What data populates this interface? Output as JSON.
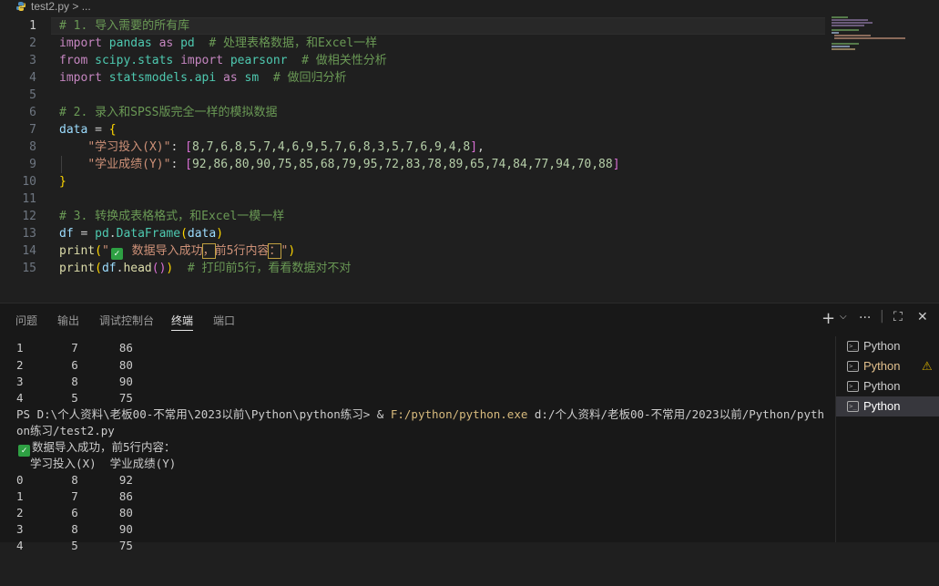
{
  "breadcrumb": {
    "file": "test2.py",
    "sep": " > ..."
  },
  "editor": {
    "line_numbers": [
      "1",
      "2",
      "3",
      "4",
      "5",
      "6",
      "7",
      "8",
      "9",
      "10",
      "11",
      "12",
      "13",
      "14",
      "15"
    ],
    "lines": {
      "l1_comment": "# 1. 导入需要的所有库",
      "l2_kw1": "import",
      "l2_mod": "pandas",
      "l2_kw2": "as",
      "l2_alias": "pd",
      "l2_comment": "# 处理表格数据，和Excel一样",
      "l3_kw1": "from",
      "l3_mod": "scipy.stats",
      "l3_kw2": "import",
      "l3_name": "pearsonr",
      "l3_comment": "# 做相关性分析",
      "l4_kw1": "import",
      "l4_mod": "statsmodels.api",
      "l4_kw2": "as",
      "l4_alias": "sm",
      "l4_comment": "# 做回归分析",
      "l6_comment": "# 2. 录入和SPSS版完全一样的模拟数据",
      "l7_var": "data",
      "l7_op": " = ",
      "l7_brace": "{",
      "l8_key": "\"学习投入(X)\"",
      "l8_colon": ": ",
      "l8_open": "[",
      "l8_vals": "8,7,6,8,5,7,4,6,9,5,7,6,8,3,5,7,6,9,4,8",
      "l8_close": "]",
      "l8_end": ",",
      "l9_key": "\"学业成绩(Y)\"",
      "l9_colon": ": ",
      "l9_open": "[",
      "l9_vals": "92,86,80,90,75,85,68,79,95,72,83,78,89,65,74,84,77,94,70,88",
      "l9_close": "]",
      "l10_brace": "}",
      "l12_comment": "# 3. 转换成表格格式，和Excel一模一样",
      "l13_var": "df",
      "l13_op": " = ",
      "l13_mod": "pd",
      "l13_dot": ".",
      "l13_fn": "DataFrame",
      "l13_open": "(",
      "l13_arg": "data",
      "l13_close": ")",
      "l14_fn": "print",
      "l14_open": "(",
      "l14_q": "\"",
      "l14_check": "✓",
      "l14_s1": " 数据导入成功",
      "l14_comma": "，",
      "l14_s2": "前5行内容",
      "l14_colon": "：",
      "l14_q2": "\"",
      "l14_close": ")",
      "l15_fn": "print",
      "l15_open": "(",
      "l15_var": "df",
      "l15_dot": ".",
      "l15_fn2": "head",
      "l15_paren": "()",
      "l15_close": ")",
      "l15_comment": "# 打印前5行，看看数据对不对"
    }
  },
  "panel": {
    "tabs": [
      "问题",
      "输出",
      "调试控制台",
      "终端",
      "端口"
    ],
    "active_tab": "终端",
    "actions": {
      "add": "+",
      "dropdown": "⌵",
      "more": "···",
      "maximize": "⛶",
      "close": "✕"
    }
  },
  "terminal": {
    "rows_top": [
      "1       7      86",
      "2       6      80",
      "3       8      90",
      "4       5      75"
    ],
    "ps_prefix": "PS D:\\个人资料\\老板00-不常用\\2023以前\\Python\\python练习> & ",
    "ps_exe": "F:/python/python.exe",
    "ps_arg": " d:/个人资料/老板00-不常用/2023以前/Python/pyth",
    "ps_wrap": "on练习/test2.py",
    "check": "✓",
    "success_msg": "数据导入成功，前5行内容：",
    "header": "  学习投入(X)  学业成绩(Y)",
    "rows_bottom": [
      "0       8      92",
      "1       7      86",
      "2       6      80",
      "3       8      90",
      "4       5      75"
    ]
  },
  "terminal_list": [
    {
      "label": "Python",
      "state": "normal"
    },
    {
      "label": "Python",
      "state": "warning"
    },
    {
      "label": "Python",
      "state": "normal"
    },
    {
      "label": "Python",
      "state": "selected"
    }
  ],
  "colors": {
    "editor_bg": "#1f1f1f",
    "panel_bg": "#181818",
    "keyword": "#c586c0",
    "comment": "#6a9955",
    "string": "#ce9178",
    "number": "#b5cea8",
    "function": "#dcdcaa",
    "module": "#4ec9b0"
  }
}
